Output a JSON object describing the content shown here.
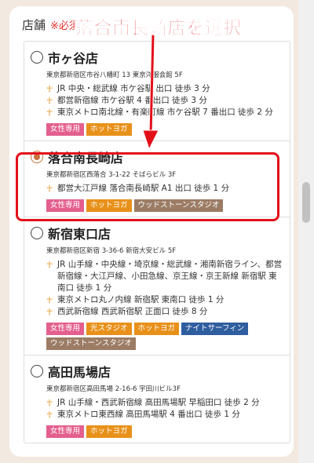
{
  "field": {
    "label": "店舗",
    "required": "※必須"
  },
  "annotation": "落合南長崎店を選択",
  "colors": {
    "pink": "#e35f8d",
    "orange": "#e8911a",
    "brown": "#9c7c65",
    "blue": "#2f5e9f",
    "accent": "#e3101a"
  },
  "stores": [
    {
      "name": "市ヶ谷店",
      "selected": false,
      "address": "東京都新宿区市谷八幡町 13 東京洋服会館 5F",
      "access": [
        "JR 中央・総武線 市ケ谷駅 出口 徒歩 3 分",
        "都営新宿線 市ケ谷駅 4 番出口 徒歩 3 分",
        "東京メトロ南北線・有楽町線 市ケ谷駅 7 番出口 徒歩 2 分"
      ],
      "tags": [
        {
          "label": "女性専用",
          "color": "pink"
        },
        {
          "label": "ホットヨガ",
          "color": "orange"
        }
      ]
    },
    {
      "name": "落合南長崎店",
      "selected": true,
      "address": "東京都新宿区西落合 3-1-22 そばらビル 3F",
      "access": [
        "都営大江戸線 落合南長崎駅 A1 出口 徒歩 1 分"
      ],
      "tags": [
        {
          "label": "女性専用",
          "color": "pink"
        },
        {
          "label": "ホットヨガ",
          "color": "orange"
        },
        {
          "label": "ウッドストーンスタジオ",
          "color": "brown"
        }
      ]
    },
    {
      "name": "新宿東口店",
      "selected": false,
      "address": "東京都新宿区新宿 3-36-6 新宿大安ビル 5F",
      "access": [
        "JR 山手線・中央線・埼京線・総武線・湘南新宿ライン、都営新宿線・大江戸線、小田急線、京王線・京王新線 新宿駅 東南口 徒歩 1 分",
        "東京メトロ丸ノ内線 新宿駅 東南口 徒歩 1 分",
        "西武新宿線 西武新宿駅 正面口 徒歩 8 分"
      ],
      "tags": [
        {
          "label": "女性専用",
          "color": "pink"
        },
        {
          "label": "光スタジオ",
          "color": "orange"
        },
        {
          "label": "ホットヨガ",
          "color": "orange"
        },
        {
          "label": "ナイトサーフィン",
          "color": "blue"
        },
        {
          "label": "ウッドストーンスタジオ",
          "color": "brown"
        }
      ]
    },
    {
      "name": "高田馬場店",
      "selected": false,
      "address": "東京都新宿区高田馬場 2-16-6 宇田川ビル3F",
      "access": [
        "JR 山手線・西武新宿線 高田馬場駅 早稲田口 徒歩 2 分",
        "東京メトロ東西線 高田馬場駅 4 番出口 徒歩 1 分"
      ],
      "tags": [
        {
          "label": "女性専用",
          "color": "pink"
        },
        {
          "label": "ホットヨガ",
          "color": "orange"
        }
      ]
    }
  ]
}
